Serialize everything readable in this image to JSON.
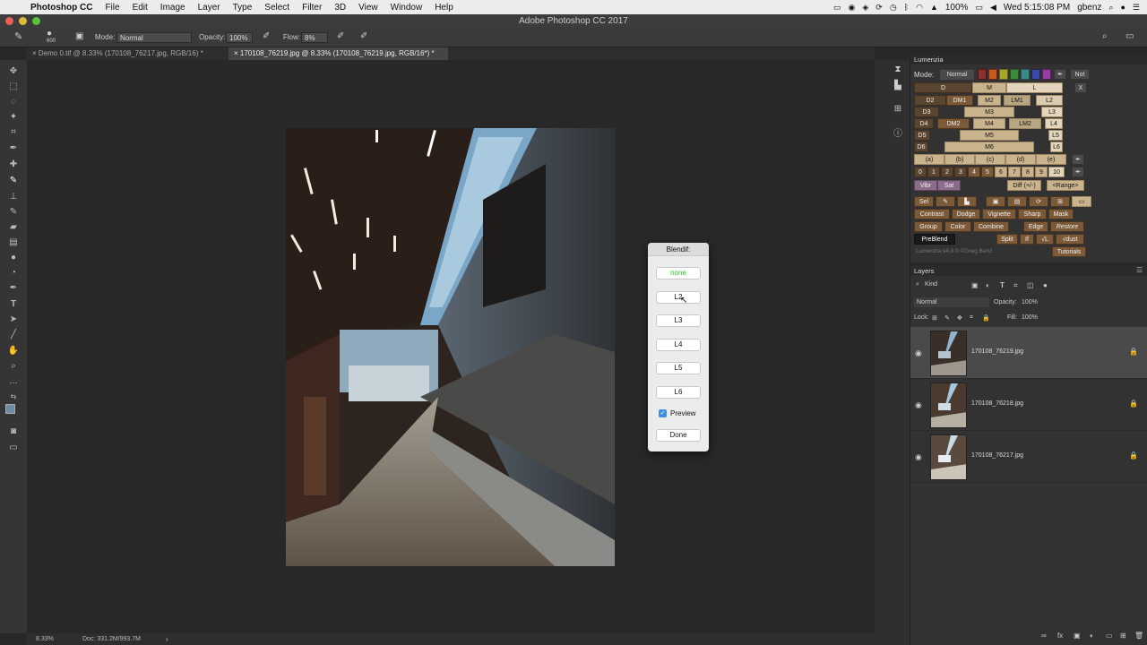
{
  "menubar": {
    "app": "Photoshop CC",
    "items": [
      "File",
      "Edit",
      "Image",
      "Layer",
      "Type",
      "Select",
      "Filter",
      "3D",
      "View",
      "Window",
      "Help"
    ],
    "battery": "100%",
    "clock": "Wed 5:15:08 PM",
    "user": "gbenz"
  },
  "window": {
    "title": "Adobe Photoshop CC 2017"
  },
  "options": {
    "brush_size": "600",
    "mode_label": "Mode:",
    "mode_value": "Normal",
    "opacity_label": "Opacity:",
    "opacity_value": "100%",
    "flow_label": "Flow:",
    "flow_value": "8%"
  },
  "tabs": [
    {
      "label": "Demo 0.tif @ 8.33% (170108_76217.jpg, RGB/16) *"
    },
    {
      "label": "170108_76219.jpg @ 8.33% (170108_76219.jpg, RGB/16*) *"
    }
  ],
  "status": {
    "zoom": "8.33%",
    "doc": "Doc: 331.2M/993.7M"
  },
  "blendif": {
    "title": "Blendif:",
    "buttons": [
      "none",
      "L2",
      "L3",
      "L4",
      "L5",
      "L6"
    ],
    "preview_label": "Preview",
    "done_label": "Done"
  },
  "lumenzia": {
    "title": "Lumenzia",
    "mode_label": "Mode:",
    "mode_value": "Normal",
    "not_label": "Not",
    "close_label": "X",
    "row1": [
      "D",
      "M",
      "L"
    ],
    "row2": [
      "D2",
      "DM1",
      "M2",
      "LM1",
      "L2"
    ],
    "row3": [
      "D3",
      "M3",
      "L3"
    ],
    "row4": [
      "D4",
      "DM2",
      "M4",
      "LM2",
      "L4"
    ],
    "row5": [
      "D5",
      "M5",
      "L5"
    ],
    "row6": [
      "D6",
      "M6",
      "L6"
    ],
    "zones": [
      "(a)",
      "(b)",
      "(c)",
      "(d)",
      "(e)"
    ],
    "nums": [
      "0",
      "1",
      "2",
      "3",
      "4",
      "5",
      "6",
      "7",
      "8",
      "9",
      "10"
    ],
    "vibr": "Vibr",
    "sat": "Sat",
    "diff": "Diff (+/-)",
    "range": "<Range>",
    "sel": "Sel",
    "tools1": [
      "Contrast",
      "Dodge",
      "Vignette",
      "Sharp",
      "Mask"
    ],
    "tools2": [
      "Group",
      "Color",
      "Combine",
      "Edge",
      "Restore"
    ],
    "preblend": "PreBlend",
    "split": "Split",
    "if": "If",
    "vl": "√L",
    "vdust": "√dust",
    "footer": "Lumenzia v4.0.0 ©Greg Benz",
    "tutorials": "Tutorials"
  },
  "layers": {
    "title": "Layers",
    "kind": "Kind",
    "blend_mode": "Normal",
    "opacity_label": "Opacity:",
    "opacity_value": "100%",
    "lock_label": "Lock:",
    "fill_label": "Fill:",
    "fill_value": "100%",
    "rows": [
      {
        "name": "170108_76219.jpg",
        "selected": true
      },
      {
        "name": "170108_76218.jpg",
        "selected": false
      },
      {
        "name": "170108_76217.jpg",
        "selected": false
      }
    ]
  }
}
